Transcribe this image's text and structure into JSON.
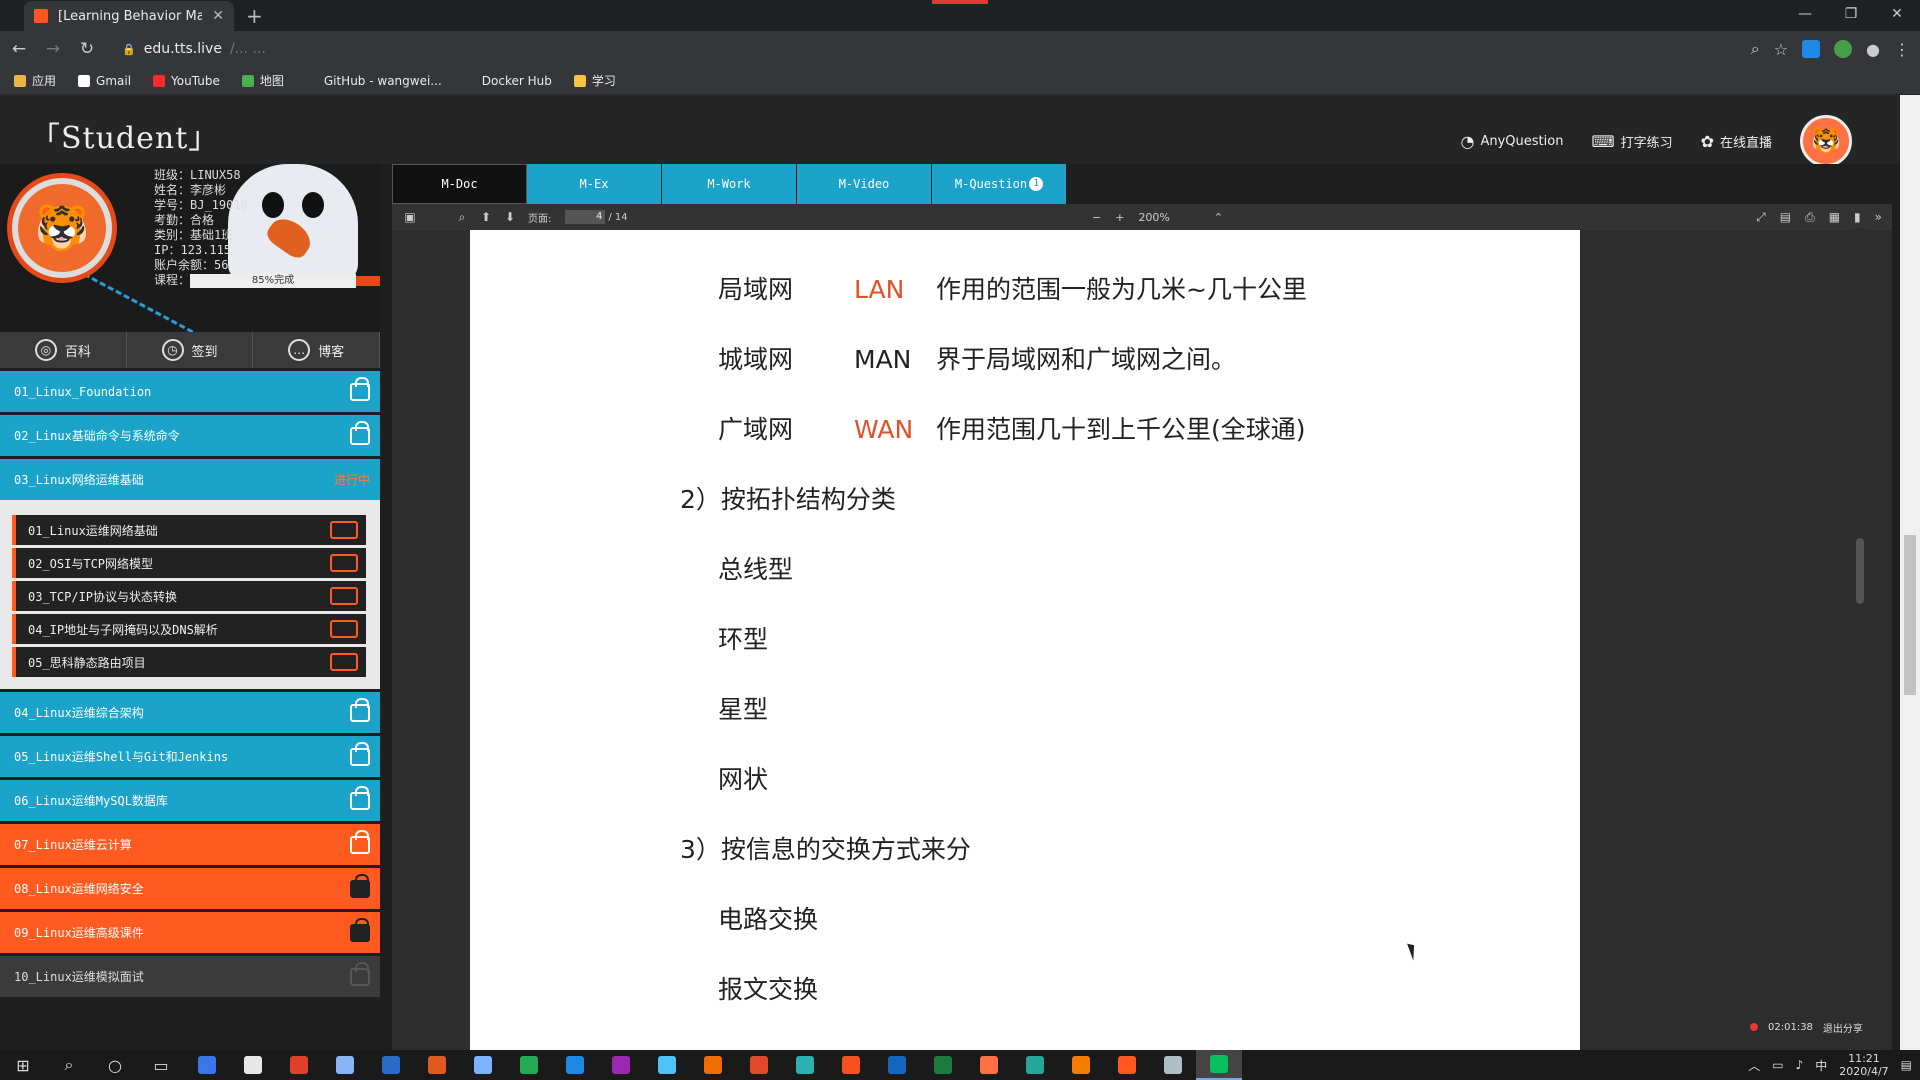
{
  "browser": {
    "tab_title": "[Learning Behavior Manage",
    "tab_close": "✕",
    "new_tab": "+",
    "url_host": "edu.tts.live",
    "url_path": "/... ...",
    "window_controls": [
      "—",
      "❐",
      "✕"
    ],
    "bookmarks": [
      {
        "label": "应用",
        "color": "#e8b548"
      },
      {
        "label": "Gmail",
        "color": "#ffffff"
      },
      {
        "label": "YouTube",
        "color": "#ff2a2a"
      },
      {
        "label": "地图",
        "color": "#4caf50"
      },
      {
        "label": "GitHub - wangwei...",
        "color": "#35363a"
      },
      {
        "label": "Docker Hub",
        "color": "#35363a"
      },
      {
        "label": "学习",
        "color": "#f5c542"
      }
    ]
  },
  "header": {
    "brand": "「Student」",
    "nav": [
      {
        "icon": "◔",
        "label": "AnyQuestion"
      },
      {
        "icon": "⌨",
        "label": "打字练习"
      },
      {
        "icon": "✿",
        "label": "在线直播"
      }
    ]
  },
  "profile": {
    "lines": [
      "班级：LINUX58",
      "姓名：李彦彬",
      "学号：BJ_19010",
      "考勤：合格",
      "类别：基础1班",
      "IP：123.115.",
      "账户余额：56",
      "课程："
    ],
    "progress_label": "85%完成",
    "progress_value": 85
  },
  "quicknav": [
    {
      "icon": "◎",
      "label": "百科"
    },
    {
      "icon": "◷",
      "label": "签到"
    },
    {
      "icon": "…",
      "label": "博客"
    }
  ],
  "courses_top": [
    {
      "label": "01_Linux_Foundation",
      "style": "blue"
    },
    {
      "label": "02_Linux基础命令与系统命令",
      "style": "blue"
    },
    {
      "label": "03_Linux网络运维基础",
      "style": "blue",
      "badge": "进行中"
    }
  ],
  "sub_lessons": [
    "01_Linux运维网络基础",
    "02_OSI与TCP网络模型",
    "03_TCP/IP协议与状态转换",
    "04_IP地址与子网掩码以及DNS解析",
    "05_思科静态路由项目"
  ],
  "courses_bottom": [
    {
      "label": "04_Linux运维综合架构",
      "style": "blue"
    },
    {
      "label": "05_Linux运维Shell与Git和Jenkins",
      "style": "blue"
    },
    {
      "label": "06_Linux运维MySQL数据库",
      "style": "blue"
    },
    {
      "label": "07_Linux运维云计算",
      "style": "orange"
    },
    {
      "label": "08_Linux运维网络安全",
      "style": "orange"
    },
    {
      "label": "09_Linux运维高级课件",
      "style": "orange"
    },
    {
      "label": "10_Linux运维模拟面试",
      "style": "dark"
    }
  ],
  "main_tabs": [
    {
      "label": "M-Doc",
      "active": true
    },
    {
      "label": "M-Ex"
    },
    {
      "label": "M-Work"
    },
    {
      "label": "M-Video"
    },
    {
      "label": "M-Question",
      "count": "1"
    }
  ],
  "viewer": {
    "page_label": "页面:",
    "page_current": "4",
    "page_total": "/ 14",
    "zoom": "200%"
  },
  "document": {
    "rows": [
      {
        "term": "局域网",
        "abbr": "LAN",
        "abbr_red": true,
        "desc": "作用的范围一般为几米~几十公里"
      },
      {
        "term": "城域网",
        "abbr": "MAN",
        "abbr_red": false,
        "desc": "界于局域网和广域网之间。"
      },
      {
        "term": "广域网",
        "abbr": "WAN",
        "abbr_red": true,
        "desc": "作用范围几十到上千公里(全球通)"
      }
    ],
    "heading2": "2）按拓扑结构分类",
    "topologies": [
      "总线型",
      "环型",
      "星型",
      "网状"
    ],
    "heading3": "3）按信息的交换方式来分",
    "switching": [
      "电路交换",
      "报文交换"
    ]
  },
  "float_bar": {
    "timer": "02:01:38",
    "exit": "退出分享"
  },
  "taskbar": {
    "apps": [
      "#3b78e7",
      "#e8e8e8",
      "#e0402a",
      "#8ab4f8",
      "#2a6bc8",
      "#e05a1f",
      "#7bb3ff",
      "#22aa55",
      "#1e88e5",
      "#9c27b0",
      "#4fc3f7",
      "#ef6c00",
      "#e04a2a",
      "#2ab0b0",
      "#f4511e",
      "#1565c0",
      "#1a7a3e",
      "#ff7043",
      "#26a69a",
      "#f57c00",
      "#ff5722",
      "#b0bec5",
      "#07c160"
    ],
    "time": "11:21",
    "date": "2020/4/7",
    "ime": "中"
  }
}
